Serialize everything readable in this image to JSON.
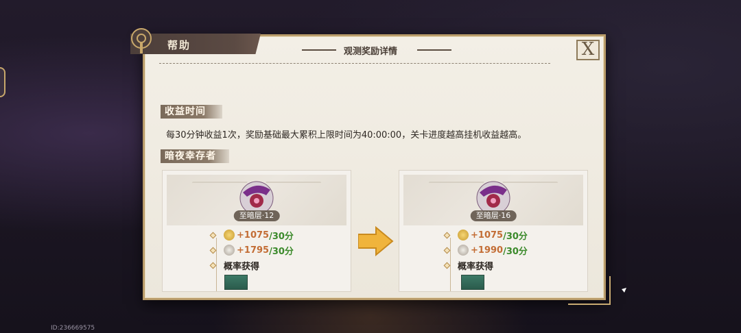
{
  "user_id": "ID:236669575",
  "help": {
    "title": "帮助"
  },
  "dialog": {
    "title": "观测奖励详情",
    "subtitle": "",
    "close_label": "X"
  },
  "sections": {
    "income_time": {
      "label": "收益时间",
      "text": "每30分钟收益1次，奖励基础最大累积上限时间为40:00:00，关卡进度越高挂机收益越高。"
    },
    "survivor": {
      "label": "暗夜幸存者"
    }
  },
  "cards": [
    {
      "level": "至暗层·12",
      "rewards": [
        {
          "amount": "+1075",
          "per": "/30分",
          "icon": "gold-coin-icon"
        },
        {
          "amount": "+1795",
          "per": "/30分",
          "icon": "magnifier-icon"
        }
      ],
      "probability_label": "概率获得"
    },
    {
      "level": "至暗层·16",
      "rewards": [
        {
          "amount": "+1075",
          "per": "/30分",
          "icon": "gold-coin-icon"
        },
        {
          "amount": "+1990",
          "per": "/30分",
          "icon": "magnifier-icon"
        }
      ],
      "probability_label": "概率获得"
    }
  ],
  "colors": {
    "amount": "#c36d35",
    "per_time": "#3b8a2b",
    "frame": "#b99c6a",
    "arrow": "#f0b43c"
  }
}
